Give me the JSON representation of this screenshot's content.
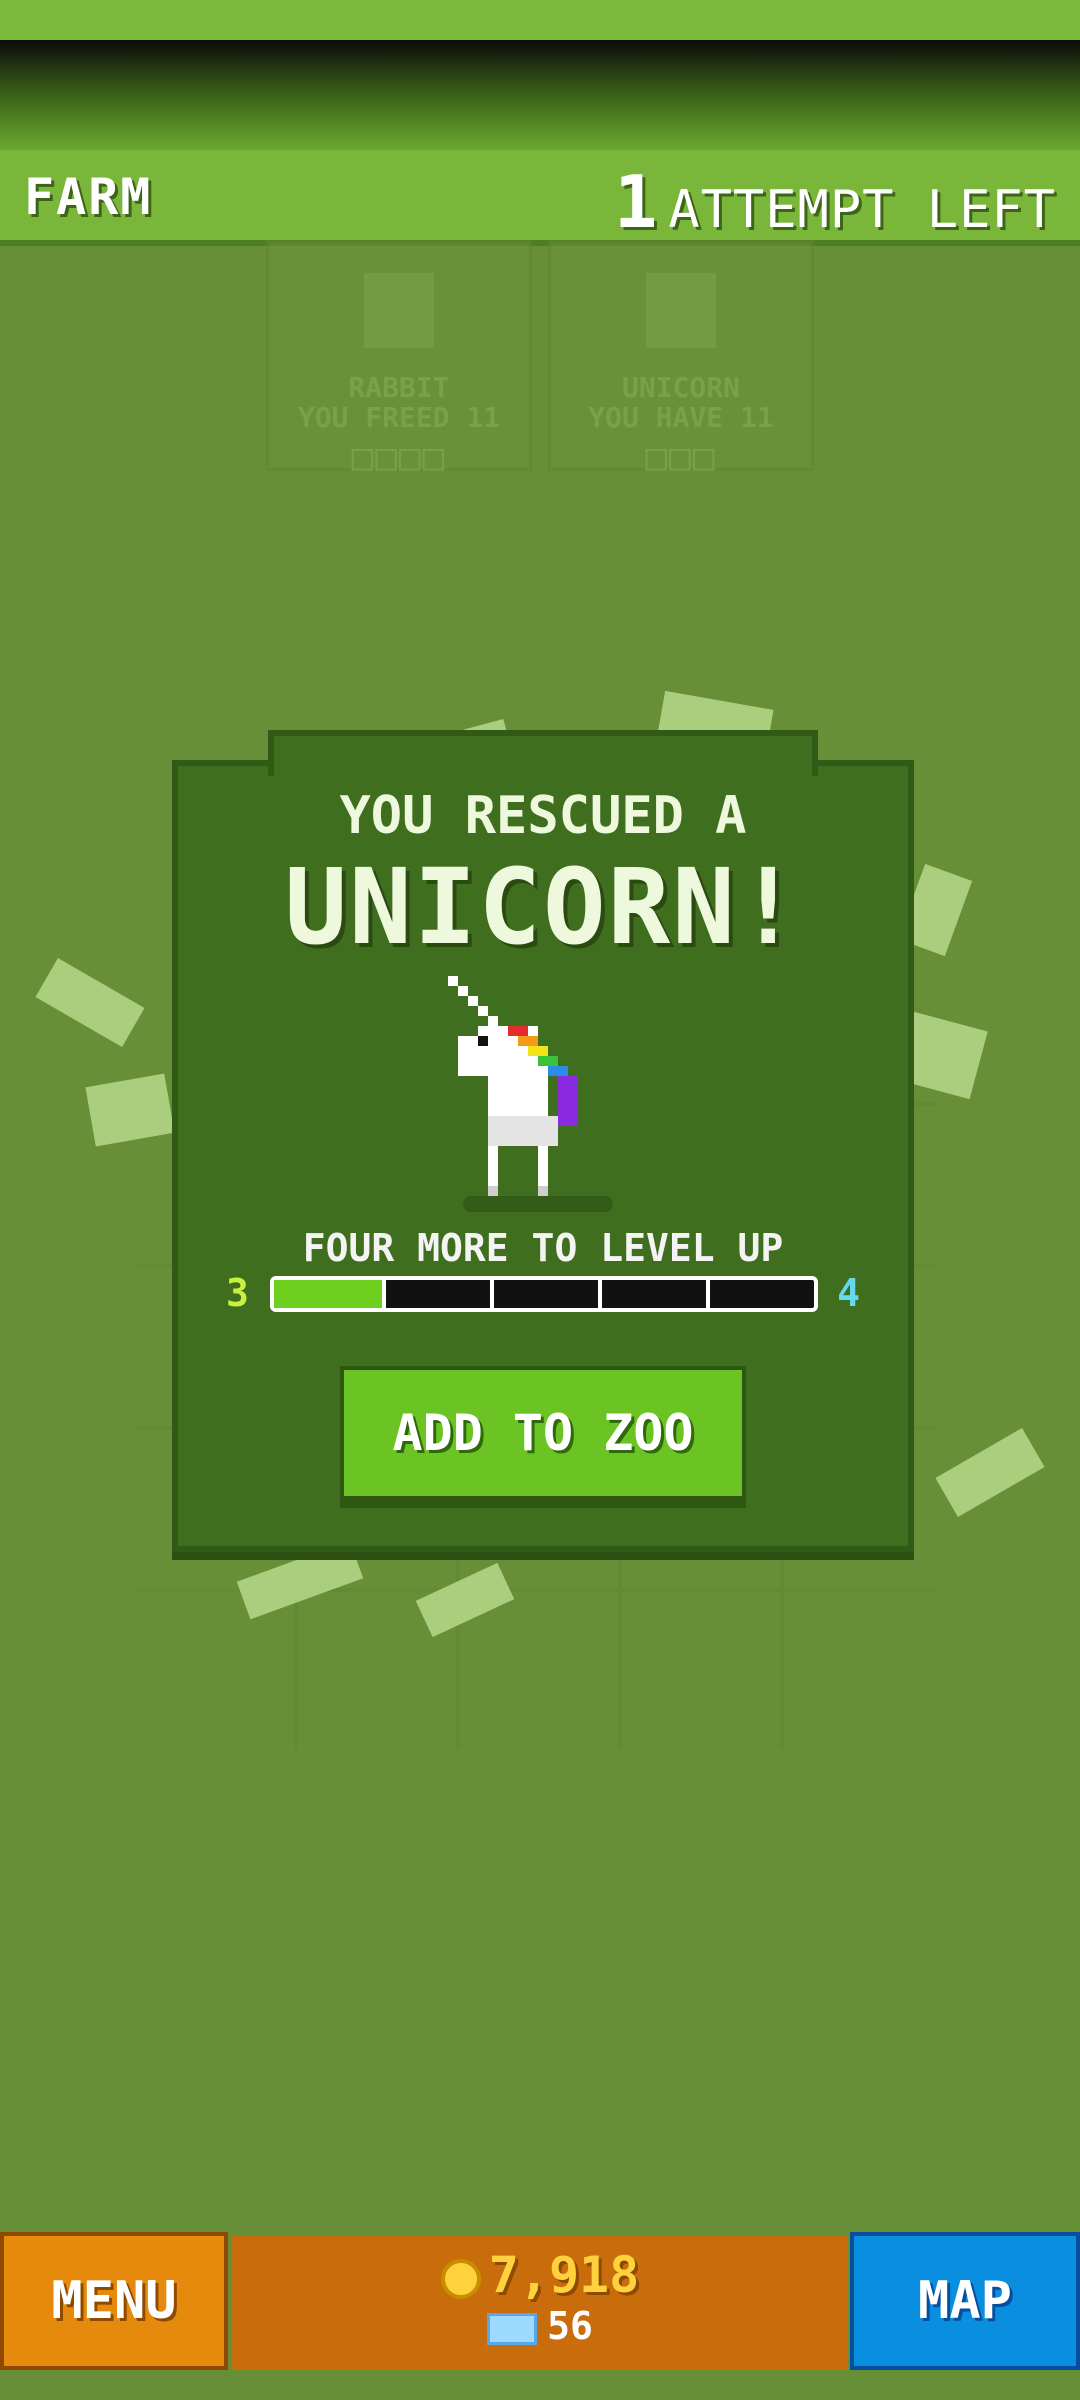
{
  "header": {
    "title": "FARM",
    "attempts_count": "1",
    "attempts_label": "ATTEMPT LEFT"
  },
  "background_cards": [
    {
      "name": "RABBIT",
      "status": "YOU FREED 11",
      "boxes": "□□□□",
      "icon": "rabbit-icon"
    },
    {
      "name": "UNICORN",
      "status": "YOU HAVE 11",
      "boxes": "□□□",
      "icon": "unicorn-icon"
    }
  ],
  "dialog": {
    "subtitle": "YOU RESCUED A",
    "title": "UNICORN!",
    "level_text": "FOUR MORE TO LEVEL UP",
    "level_from": "3",
    "level_to": "4",
    "progress_fraction": 0.2,
    "progress_segments": 5,
    "button_label": "ADD TO ZOO",
    "image": "unicorn-icon"
  },
  "bottom": {
    "menu_label": "MENU",
    "coins": "7,918",
    "gems": "56",
    "map_label": "MAP"
  },
  "colors": {
    "accent_green": "#6cc424",
    "menu_orange": "#e58a0d",
    "map_blue": "#0a8ee0",
    "coin_yellow": "#ffd23d"
  }
}
